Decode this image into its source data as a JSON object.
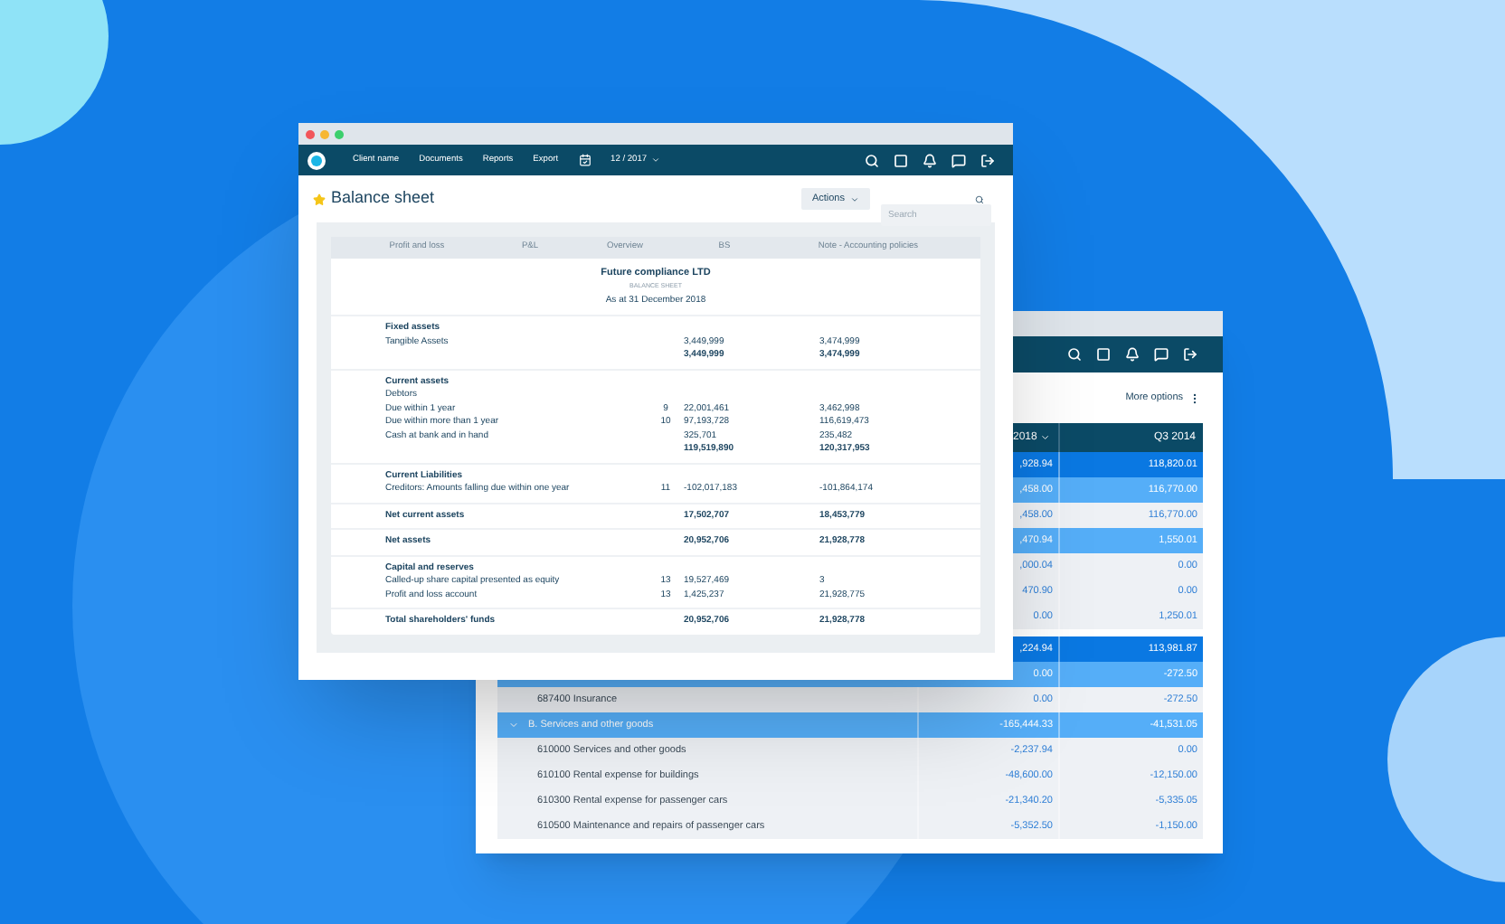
{
  "back_window": {
    "more_options": "More options",
    "columns": [
      {
        "label": "2018",
        "dropdown": true
      },
      {
        "label": "Q3 2014",
        "dropdown": false
      }
    ],
    "row_groups": [
      [
        {
          "kind": "item",
          "color": "#0a78e2",
          "values": [
            ",928.94",
            "118,820.01"
          ]
        },
        {
          "kind": "item",
          "color": "#55aef8",
          "values": [
            ",458.00",
            "116,770.00"
          ]
        },
        {
          "kind": "item",
          "color": "#eef1f5",
          "values": [
            ",458.00",
            "116,770.00"
          ]
        },
        {
          "kind": "item",
          "color": "#55aef8",
          "values": [
            ",470.94",
            "1,550.01"
          ]
        },
        {
          "kind": "item",
          "color": "#eef1f5",
          "values": [
            ",000.04",
            "0.00"
          ]
        },
        {
          "kind": "item",
          "color": "#eef1f5",
          "values": [
            "470.90",
            "0.00"
          ]
        },
        {
          "kind": "item",
          "color": "#eef1f5",
          "values": [
            "0.00",
            "1,250.01"
          ]
        }
      ],
      [
        {
          "kind": "item",
          "color": "#0a78e2",
          "values": [
            ",224.94",
            "113,981.87"
          ]
        },
        {
          "kind": "item",
          "color": "#55aef8",
          "values": [
            "0.00",
            "-272.50"
          ]
        },
        {
          "kind": "item",
          "color": "#eef1f5",
          "label": "687400 Insurance",
          "values": [
            "0.00",
            "-272.50"
          ]
        },
        {
          "kind": "group",
          "color": "#55aef8",
          "label": "B. Services and other goods",
          "values": [
            "-165,444.33",
            "-41,531.05"
          ]
        },
        {
          "kind": "item",
          "color": "#eef1f5",
          "label": "610000 Services and other goods",
          "values": [
            "-2,237.94",
            "0.00"
          ]
        },
        {
          "kind": "item",
          "color": "#eef1f5",
          "label": "610100 Rental expense for buildings",
          "values": [
            "-48,600.00",
            "-12,150.00"
          ]
        },
        {
          "kind": "item",
          "color": "#eef1f5",
          "label": "610300 Rental expense for passenger cars",
          "values": [
            "-21,340.20",
            "-5,335.05"
          ]
        },
        {
          "kind": "item",
          "color": "#eef1f5",
          "label": "610500 Maintenance and repairs of passenger cars",
          "values": [
            "-5,352.50",
            "-1,150.00"
          ]
        }
      ]
    ]
  },
  "front_window": {
    "nav": {
      "items": [
        "Client name",
        "Documents",
        "Reports",
        "Export"
      ],
      "period": "12 / 2017"
    },
    "title": "Balance sheet",
    "starred": true,
    "actions_button": "Actions",
    "search": {
      "placeholder": "Search"
    },
    "tabs": [
      "Profit and loss",
      "P&L",
      "Overview",
      "BS",
      "Note - Accounting policies"
    ],
    "report": {
      "company": "Future compliance LTD",
      "subtitle": "BALANCE SHEET",
      "date": "As at 31 December 2018",
      "sections": [
        [
          {
            "label": "Fixed assets",
            "bold": true
          },
          {
            "label": "Tangible Assets",
            "values": [
              "3,449,999",
              "3,474,999"
            ],
            "bold": false
          },
          {
            "values": [
              "3,449,999",
              "3,474,999"
            ],
            "bold": true
          }
        ],
        [
          {
            "label": "Current assets",
            "bold": true
          },
          {
            "label": "Debtors",
            "bold": false
          },
          {
            "label": "Due within 1 year",
            "note": "9",
            "values": [
              "22,001,461",
              "3,462,998"
            ],
            "bold": false
          },
          {
            "label": "Due within more than 1 year",
            "note": "10",
            "values": [
              "97,193,728",
              "116,619,473"
            ],
            "bold": false
          },
          {
            "label": "Cash at bank and in hand",
            "values": [
              "325,701",
              "235,482"
            ],
            "bold": false
          },
          {
            "values": [
              "119,519,890",
              "120,317,953"
            ],
            "bold": true
          }
        ],
        [
          {
            "label": "Current Liabilities",
            "bold": true
          },
          {
            "label": "Creditors: Amounts falling due within one year",
            "note": "11",
            "values": [
              "-102,017,183",
              "-101,864,174"
            ],
            "bold": false
          }
        ],
        [
          {
            "label": "Net current assets",
            "values": [
              "17,502,707",
              "18,453,779"
            ],
            "bold": true
          }
        ],
        [
          {
            "label": "Net assets",
            "values": [
              "20,952,706",
              "21,928,778"
            ],
            "bold": true
          }
        ],
        [
          {
            "label": "Capital and reserves",
            "bold": true
          },
          {
            "label": "Called-up share capital presented as equity",
            "note": "13",
            "values": [
              "19,527,469",
              "3"
            ],
            "bold": false
          },
          {
            "label": "Profit and loss account",
            "note": "13",
            "values": [
              "1,425,237",
              "21,928,775"
            ],
            "bold": false
          }
        ],
        [
          {
            "label": "Total shareholders' funds",
            "values": [
              "20,952,706",
              "21,928,778"
            ],
            "bold": true
          }
        ]
      ]
    }
  }
}
